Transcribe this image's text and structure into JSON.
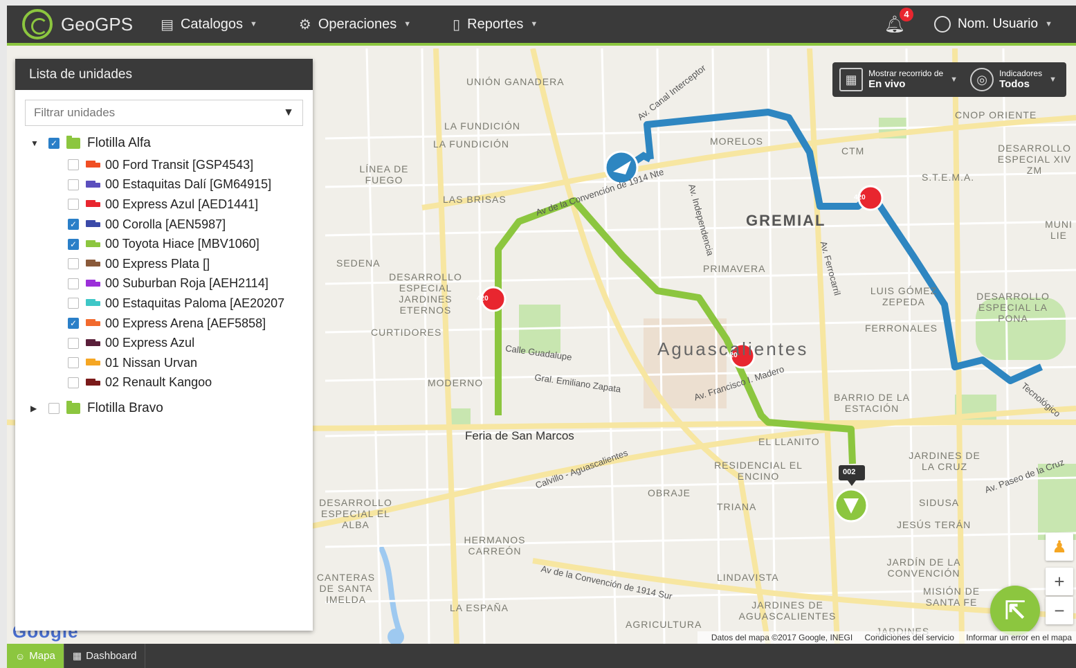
{
  "header": {
    "logo_text": "GeoGPS",
    "nav": [
      {
        "label": "Catalogos",
        "icon": "clipboard-icon"
      },
      {
        "label": "Operaciones",
        "icon": "gears-icon"
      },
      {
        "label": "Reportes",
        "icon": "document-icon"
      }
    ],
    "notifications_count": "4",
    "user_label": "Nom. Usuario"
  },
  "panel": {
    "title": "Lista de unidades",
    "filter_placeholder": "Filtrar unidades",
    "groups": [
      {
        "name": "Flotilla Alfa",
        "expanded": true,
        "checked": true,
        "units": [
          {
            "label": "00 Ford Transit [GSP4543]",
            "checked": false,
            "color": "#f04e23"
          },
          {
            "label": "00 Estaquitas Dalí [GM64915]",
            "checked": false,
            "color": "#5b4fbd"
          },
          {
            "label": "00 Express Azul [AED1441]",
            "checked": false,
            "color": "#e8262f"
          },
          {
            "label": "00 Corolla [AEN5987]",
            "checked": true,
            "color": "#3b4aa8"
          },
          {
            "label": "00 Toyota Hiace [MBV1060]",
            "checked": true,
            "color": "#8cc63f"
          },
          {
            "label": "00 Express Plata []",
            "checked": false,
            "color": "#8a5a3a"
          },
          {
            "label": "00 Suburban Roja [AEH2114]",
            "checked": false,
            "color": "#9b30d9"
          },
          {
            "label": "00 Estaquitas Paloma [AE20207",
            "checked": false,
            "color": "#3fc7c7"
          },
          {
            "label": "00 Express Arena [AEF5858]",
            "checked": true,
            "color": "#f26a2e"
          },
          {
            "label": "00 Express Azul",
            "checked": false,
            "color": "#5a1f3a"
          },
          {
            "label": "01 Nissan Urvan",
            "checked": false,
            "color": "#f5a623"
          },
          {
            "label": "02 Renault Kangoo",
            "checked": false,
            "color": "#7a1a1a"
          }
        ]
      },
      {
        "name": "Flotilla Bravo",
        "expanded": false,
        "checked": false,
        "units": []
      }
    ]
  },
  "map_controls": {
    "route_label_top": "Mostrar recorrido de",
    "route_label_bottom": "En vivo",
    "indicators_top": "Indicadores",
    "indicators_bottom": "Todos"
  },
  "map": {
    "labels": [
      "UNIÓN GANADERA",
      "LA FUNDICIÓN",
      "LA FUNDICIÓN",
      "LÍNEA DE FUEGO",
      "LAS BRISAS",
      "SEDENA",
      "DESARROLLO ESPECIAL JARDINES ETERNOS",
      "CURTIDORES",
      "MODERNO",
      "MORELOS",
      "CTM",
      "GREMIAL",
      "PRIMAVERA",
      "S.T.E.M.A.",
      "CNOP ORIENTE",
      "DESARROLLO ESPECIAL XIV ZM",
      "LUIS GÓMEZ ZEPEDA",
      "FERRONALES",
      "DESARROLLO ESPECIAL LA PONA",
      "BARRIO DE LA ESTACIÓN",
      "EL LLANITO",
      "RESIDENCIAL EL ENCINO",
      "OBRAJE",
      "TRIANA",
      "JARDINES DE LA CRUZ",
      "SIDUSA",
      "JESÚS TERÁN",
      "JARDÍN DE LA CONVENCIÓN",
      "MISIÓN DE SANTA FE",
      "LINDAVISTA",
      "JARDINES DE AGUASCALIENTES",
      "AGRICULTURA",
      "HERMANOS CARREÓN",
      "LA ESPAÑA",
      "DESARROLLO ESPECIAL EL ALBA",
      "CANTERAS DE SANTA IMELDA",
      "JARDINES",
      "MUNI LIE"
    ],
    "city": "Aguascalientes",
    "poi": "Feria de San Marcos",
    "streets": [
      "Av de la Convención de 1914 Nte",
      "Calvillo - Aguascalientes",
      "Av de la Convención de 1914 Sur",
      "Calle Guadalupe",
      "Gral. Emiliano Zapata",
      "Av. Francisco I. Madero",
      "Av. Canal Interceptor",
      "Av. Independencia",
      "Av. Ferrocarril",
      "Av. Paseo de la Cruz",
      "Tecnológico"
    ],
    "vehicle_tag": "002",
    "attribution": [
      "Datos del mapa ©2017 Google, INEGI",
      "Condiciones del servicio",
      "Informar un error en el mapa"
    ],
    "google_logo": "Google",
    "marker_label": "420"
  },
  "bottom_tabs": [
    {
      "label": "Mapa",
      "icon": "person-icon",
      "active": true
    },
    {
      "label": "Dashboard",
      "icon": "grid-icon",
      "active": false
    }
  ],
  "colors": {
    "accent": "#8cc63f",
    "header": "#3a3a3a",
    "route_blue": "#2e86c1",
    "route_green": "#8cc63f",
    "marker_red": "#e8262f"
  }
}
